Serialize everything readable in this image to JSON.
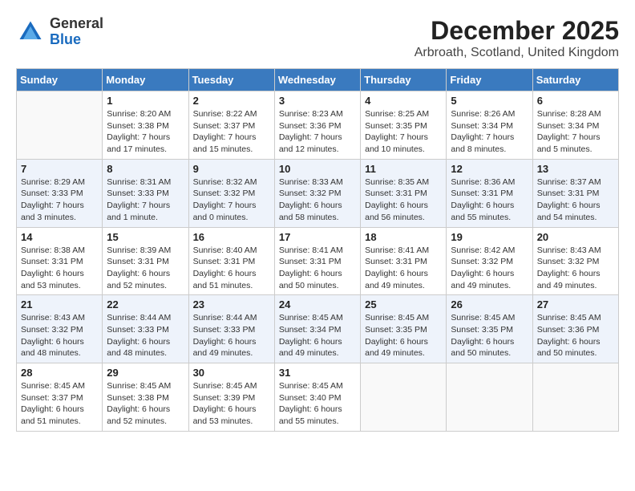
{
  "app": {
    "name": "GeneralBlue",
    "logo_general": "General",
    "logo_blue": "Blue"
  },
  "header": {
    "month": "December 2025",
    "location": "Arbroath, Scotland, United Kingdom"
  },
  "weekdays": [
    "Sunday",
    "Monday",
    "Tuesday",
    "Wednesday",
    "Thursday",
    "Friday",
    "Saturday"
  ],
  "weeks": [
    [
      {
        "day": "",
        "info": ""
      },
      {
        "day": "1",
        "info": "Sunrise: 8:20 AM\nSunset: 3:38 PM\nDaylight: 7 hours\nand 17 minutes."
      },
      {
        "day": "2",
        "info": "Sunrise: 8:22 AM\nSunset: 3:37 PM\nDaylight: 7 hours\nand 15 minutes."
      },
      {
        "day": "3",
        "info": "Sunrise: 8:23 AM\nSunset: 3:36 PM\nDaylight: 7 hours\nand 12 minutes."
      },
      {
        "day": "4",
        "info": "Sunrise: 8:25 AM\nSunset: 3:35 PM\nDaylight: 7 hours\nand 10 minutes."
      },
      {
        "day": "5",
        "info": "Sunrise: 8:26 AM\nSunset: 3:34 PM\nDaylight: 7 hours\nand 8 minutes."
      },
      {
        "day": "6",
        "info": "Sunrise: 8:28 AM\nSunset: 3:34 PM\nDaylight: 7 hours\nand 5 minutes."
      }
    ],
    [
      {
        "day": "7",
        "info": "Sunrise: 8:29 AM\nSunset: 3:33 PM\nDaylight: 7 hours\nand 3 minutes."
      },
      {
        "day": "8",
        "info": "Sunrise: 8:31 AM\nSunset: 3:33 PM\nDaylight: 7 hours\nand 1 minute."
      },
      {
        "day": "9",
        "info": "Sunrise: 8:32 AM\nSunset: 3:32 PM\nDaylight: 7 hours\nand 0 minutes."
      },
      {
        "day": "10",
        "info": "Sunrise: 8:33 AM\nSunset: 3:32 PM\nDaylight: 6 hours\nand 58 minutes."
      },
      {
        "day": "11",
        "info": "Sunrise: 8:35 AM\nSunset: 3:31 PM\nDaylight: 6 hours\nand 56 minutes."
      },
      {
        "day": "12",
        "info": "Sunrise: 8:36 AM\nSunset: 3:31 PM\nDaylight: 6 hours\nand 55 minutes."
      },
      {
        "day": "13",
        "info": "Sunrise: 8:37 AM\nSunset: 3:31 PM\nDaylight: 6 hours\nand 54 minutes."
      }
    ],
    [
      {
        "day": "14",
        "info": "Sunrise: 8:38 AM\nSunset: 3:31 PM\nDaylight: 6 hours\nand 53 minutes."
      },
      {
        "day": "15",
        "info": "Sunrise: 8:39 AM\nSunset: 3:31 PM\nDaylight: 6 hours\nand 52 minutes."
      },
      {
        "day": "16",
        "info": "Sunrise: 8:40 AM\nSunset: 3:31 PM\nDaylight: 6 hours\nand 51 minutes."
      },
      {
        "day": "17",
        "info": "Sunrise: 8:41 AM\nSunset: 3:31 PM\nDaylight: 6 hours\nand 50 minutes."
      },
      {
        "day": "18",
        "info": "Sunrise: 8:41 AM\nSunset: 3:31 PM\nDaylight: 6 hours\nand 49 minutes."
      },
      {
        "day": "19",
        "info": "Sunrise: 8:42 AM\nSunset: 3:32 PM\nDaylight: 6 hours\nand 49 minutes."
      },
      {
        "day": "20",
        "info": "Sunrise: 8:43 AM\nSunset: 3:32 PM\nDaylight: 6 hours\nand 49 minutes."
      }
    ],
    [
      {
        "day": "21",
        "info": "Sunrise: 8:43 AM\nSunset: 3:32 PM\nDaylight: 6 hours\nand 48 minutes."
      },
      {
        "day": "22",
        "info": "Sunrise: 8:44 AM\nSunset: 3:33 PM\nDaylight: 6 hours\nand 48 minutes."
      },
      {
        "day": "23",
        "info": "Sunrise: 8:44 AM\nSunset: 3:33 PM\nDaylight: 6 hours\nand 49 minutes."
      },
      {
        "day": "24",
        "info": "Sunrise: 8:45 AM\nSunset: 3:34 PM\nDaylight: 6 hours\nand 49 minutes."
      },
      {
        "day": "25",
        "info": "Sunrise: 8:45 AM\nSunset: 3:35 PM\nDaylight: 6 hours\nand 49 minutes."
      },
      {
        "day": "26",
        "info": "Sunrise: 8:45 AM\nSunset: 3:35 PM\nDaylight: 6 hours\nand 50 minutes."
      },
      {
        "day": "27",
        "info": "Sunrise: 8:45 AM\nSunset: 3:36 PM\nDaylight: 6 hours\nand 50 minutes."
      }
    ],
    [
      {
        "day": "28",
        "info": "Sunrise: 8:45 AM\nSunset: 3:37 PM\nDaylight: 6 hours\nand 51 minutes."
      },
      {
        "day": "29",
        "info": "Sunrise: 8:45 AM\nSunset: 3:38 PM\nDaylight: 6 hours\nand 52 minutes."
      },
      {
        "day": "30",
        "info": "Sunrise: 8:45 AM\nSunset: 3:39 PM\nDaylight: 6 hours\nand 53 minutes."
      },
      {
        "day": "31",
        "info": "Sunrise: 8:45 AM\nSunset: 3:40 PM\nDaylight: 6 hours\nand 55 minutes."
      },
      {
        "day": "",
        "info": ""
      },
      {
        "day": "",
        "info": ""
      },
      {
        "day": "",
        "info": ""
      }
    ]
  ]
}
